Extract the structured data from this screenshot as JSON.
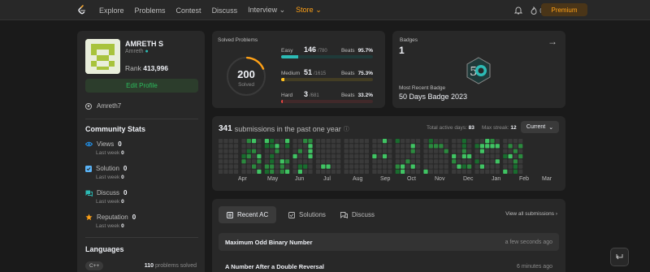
{
  "nav": {
    "links": [
      "Explore",
      "Problems",
      "Contest",
      "Discuss",
      "Interview",
      "Store"
    ],
    "notification_count": "0",
    "premium_label": "Premium"
  },
  "profile": {
    "name": "AMRETH S",
    "username": "Amreth",
    "rank_label": "Rank",
    "rank_value": "413,996",
    "edit_label": "Edit Profile",
    "github": "Amreth7"
  },
  "community": {
    "title": "Community Stats",
    "stats": [
      {
        "label": "Views",
        "value": "0",
        "sub_label": "Last week",
        "sub_value": "0",
        "icon": "eye-icon",
        "color": "#2196f3"
      },
      {
        "label": "Solution",
        "value": "0",
        "sub_label": "Last week",
        "sub_value": "0",
        "icon": "checkbox-icon",
        "color": "#5ab4f7"
      },
      {
        "label": "Discuss",
        "value": "0",
        "sub_label": "Last week",
        "sub_value": "0",
        "icon": "chat-icon",
        "color": "#2cbbb5"
      },
      {
        "label": "Reputation",
        "value": "0",
        "sub_label": "Last week",
        "sub_value": "0",
        "icon": "star-icon",
        "color": "#ffa116"
      }
    ]
  },
  "languages": {
    "title": "Languages",
    "items": [
      {
        "name": "C++",
        "count": "110",
        "suffix": "problems solved"
      }
    ]
  },
  "solved": {
    "title": "Solved Problems",
    "total": "200",
    "total_label": "Solved",
    "difficulties": [
      {
        "name": "Easy",
        "count": "146",
        "total": "/780",
        "beats_label": "Beats",
        "beats": "95.7%",
        "progress": 0.187,
        "color": "#2cbbb5",
        "track": "#1f3a39"
      },
      {
        "name": "Medium",
        "count": "51",
        "total": "/1615",
        "beats_label": "Beats",
        "beats": "75.3%",
        "progress": 0.032,
        "color": "#ffc01e",
        "track": "#433d24"
      },
      {
        "name": "Hard",
        "count": "3",
        "total": "/681",
        "beats_label": "Beats",
        "beats": "33.2%",
        "progress": 0.004,
        "color": "#ef4743",
        "track": "#41292a"
      }
    ]
  },
  "badges": {
    "title": "Badges",
    "count": "1",
    "recent_label": "Most Recent Badge",
    "recent_name": "50 Days Badge 2023"
  },
  "submissions": {
    "count": "341",
    "text": "submissions in the past one year",
    "active_days_label": "Total active days:",
    "active_days": "83",
    "max_streak_label": "Max streak:",
    "max_streak": "12",
    "dropdown": "Current",
    "months": [
      "Apr",
      "May",
      "Jun",
      "Jul",
      "Aug",
      "Sep",
      "Oct",
      "Nov",
      "Dec",
      "Jan",
      "Feb",
      "Mar"
    ]
  },
  "recent": {
    "tabs": [
      {
        "label": "Recent AC",
        "icon": "list-icon"
      },
      {
        "label": "Solutions",
        "icon": "checkbox-icon"
      },
      {
        "label": "Discuss",
        "icon": "chat-icon"
      }
    ],
    "view_all": "View all submissions",
    "items": [
      {
        "title": "Maximum Odd Binary Number",
        "time": "a few seconds ago"
      },
      {
        "title": "A Number After a Double Reversal",
        "time": "6 minutes ago"
      }
    ]
  }
}
